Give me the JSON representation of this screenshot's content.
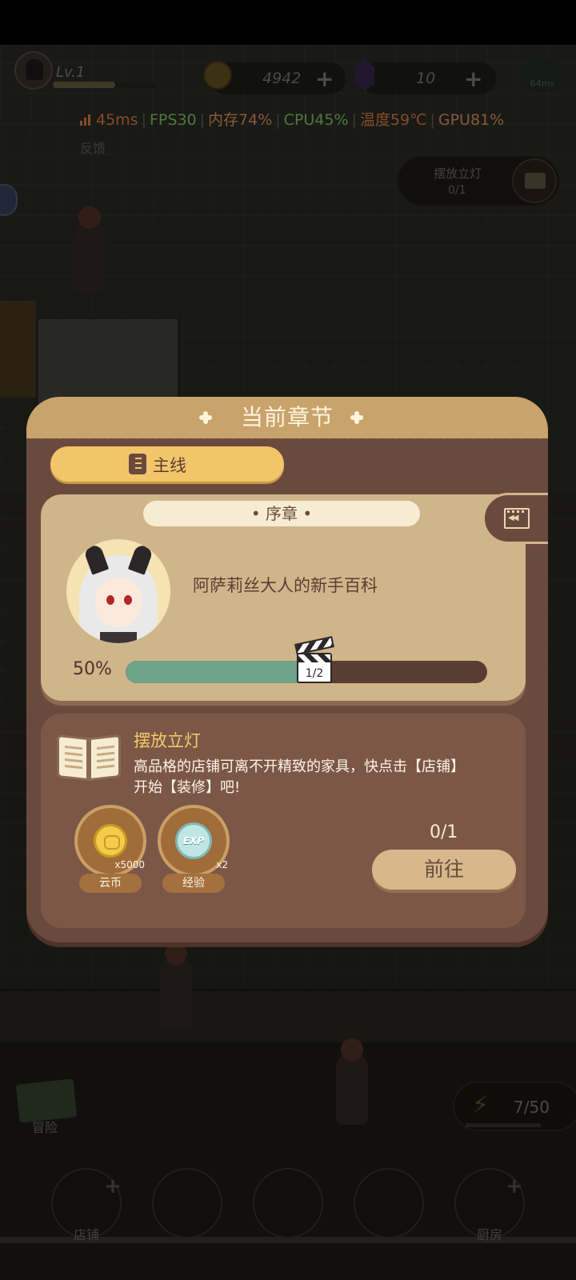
{
  "hud": {
    "level": "Lv.1",
    "coins": "4942",
    "gems": "10",
    "plus": "+",
    "ping": "64ms",
    "feedback": "反馈",
    "side_quest": {
      "title": "摆放立灯",
      "progress": "0/1"
    }
  },
  "perf": {
    "latency": "45ms",
    "fps": "FPS30",
    "memory": "内存74%",
    "cpu": "CPU45%",
    "temperature": "温度59℃",
    "gpu": "GPU81%",
    "separator": "|",
    "colors": {
      "latency": "#f28a4a",
      "fps": "#8fdc6e",
      "memory": "#f5a46a",
      "cpu": "#8fdc6e",
      "temperature": "#f28a4a",
      "gpu": "#f5a46a"
    }
  },
  "modal": {
    "title": "当前章节",
    "tab_main": "主线",
    "chapter": {
      "tag": "• 序章 •",
      "name": "阿萨莉丝大人的新手百科",
      "percent_label": "50%",
      "progress": 0.5,
      "step_count": "1/2"
    },
    "task": {
      "title": "摆放立灯",
      "description": "高品格的店铺可离不开精致的家具，快点击【店铺】开始【装修】吧!",
      "rewards": [
        {
          "icon": "cloud-coin-icon",
          "qty": "x5000",
          "label": "云币"
        },
        {
          "icon": "exp-icon",
          "qty": "x2",
          "exp_text": "EXP",
          "label": "经验"
        }
      ],
      "progress": "0/1",
      "go_label": "前往"
    }
  },
  "bottom": {
    "adventure": "冒险",
    "stamina": "7/50",
    "dock": [
      {
        "label": "店铺"
      },
      {
        "label": ""
      },
      {
        "label": ""
      },
      {
        "label": ""
      },
      {
        "label": "厨房"
      }
    ]
  },
  "colors": {
    "modal_bg": "#6b4a3e",
    "header": "#c8a36c",
    "accent": "#f3c56a",
    "progress_fill": "#6fa38a"
  }
}
